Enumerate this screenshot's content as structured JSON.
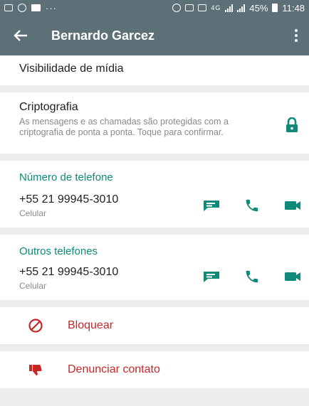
{
  "status_bar": {
    "dots": "···",
    "network": "4G",
    "battery": "45%",
    "time": "11:48"
  },
  "app_bar": {
    "title": "Bernardo Garcez",
    "back_icon": "arrow-left-icon",
    "menu_icon": "more-vertical-icon"
  },
  "media_visibility": {
    "label": "Visibilidade de mídia"
  },
  "encryption": {
    "title": "Criptografia",
    "description": "As mensagens e as chamadas são protegidas com a criptografia de ponta a ponta. Toque para confirmar.",
    "icon": "lock-icon"
  },
  "phone_section": {
    "title": "Número de telefone",
    "number": "+55 21 99945-3010",
    "type": "Celular"
  },
  "other_phones_section": {
    "title": "Outros telefones",
    "number": "+55 21 99945-3010",
    "type": "Celular"
  },
  "actions": {
    "message_icon": "message-icon",
    "call_icon": "phone-icon",
    "video_icon": "video-icon"
  },
  "block": {
    "label": "Bloquear",
    "icon": "block-icon"
  },
  "report": {
    "label": "Denunciar contato",
    "icon": "thumbs-down-icon"
  },
  "colors": {
    "app_bar": "#5d7077",
    "accent_green": "#0f8a78",
    "danger_red": "#c62828",
    "background": "#ececec"
  }
}
